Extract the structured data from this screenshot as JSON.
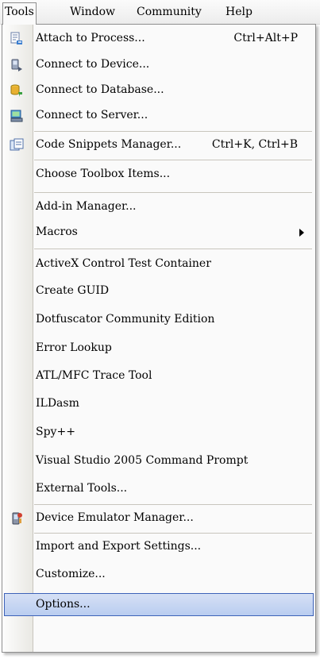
{
  "menubar": {
    "tools": "Tools",
    "window": "Window",
    "community": "Community",
    "help": "Help"
  },
  "menu": {
    "attach_to_process": {
      "label": "Attach to Process...",
      "shortcut": "Ctrl+Alt+P",
      "icon": "attach-process-icon"
    },
    "connect_to_device": {
      "label": "Connect to Device...",
      "icon": "device-icon"
    },
    "connect_to_database": {
      "label": "Connect to Database...",
      "icon": "database-icon"
    },
    "connect_to_server": {
      "label": "Connect to Server...",
      "icon": "server-icon"
    },
    "code_snippets_manager": {
      "label": "Code Snippets Manager...",
      "shortcut": "Ctrl+K, Ctrl+B",
      "icon": "snippets-icon"
    },
    "choose_toolbox_items": {
      "label": "Choose Toolbox Items..."
    },
    "addin_manager": {
      "label": "Add-in Manager..."
    },
    "macros": {
      "label": "Macros"
    },
    "activex_control_test_container": {
      "label": "ActiveX Control Test Container"
    },
    "create_guid": {
      "label": "Create GUID"
    },
    "dotfuscator": {
      "label": "Dotfuscator Community Edition"
    },
    "error_lookup": {
      "label": "Error Lookup"
    },
    "atl_mfc_trace_tool": {
      "label": "ATL/MFC Trace Tool"
    },
    "ildasm": {
      "label": "ILDasm"
    },
    "spy": {
      "label": "Spy++"
    },
    "vs2005_command_prompt": {
      "label": "Visual Studio 2005 Command Prompt"
    },
    "external_tools": {
      "label": "External Tools..."
    },
    "device_emulator_manager": {
      "label": "Device Emulator Manager...",
      "icon": "emulator-icon"
    },
    "import_export_settings": {
      "label": "Import and Export Settings..."
    },
    "customize": {
      "label": "Customize..."
    },
    "options": {
      "label": "Options..."
    }
  },
  "colors": {
    "selection_fill": "#c1d2ee",
    "selection_border": "#3d62b8",
    "gutter": "#e9e8e3"
  }
}
